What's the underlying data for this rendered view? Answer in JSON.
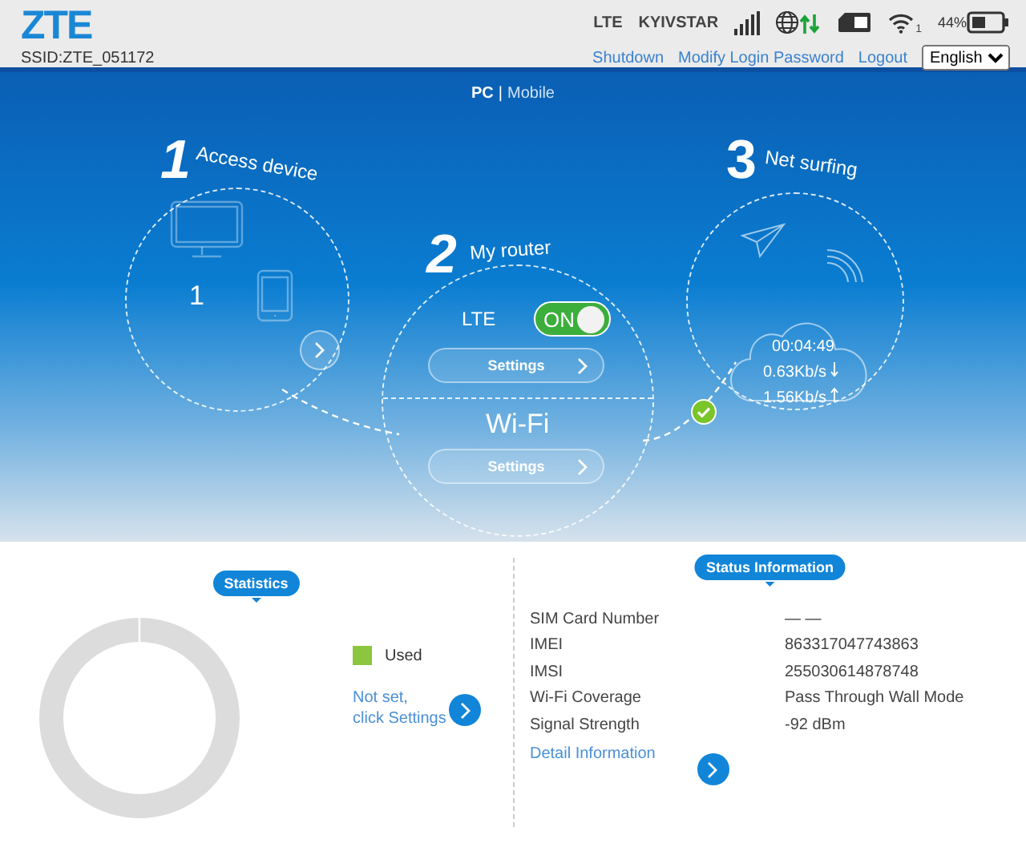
{
  "header": {
    "logo": "ZTE",
    "ssid": "SSID:ZTE_051172",
    "network_type": "LTE",
    "operator": "KYIVSTAR",
    "wifi_clients": "1",
    "battery_percent": "44%",
    "links": [
      "Shutdown",
      "Modify Login Password",
      "Logout"
    ],
    "language": "English"
  },
  "view_switch": [
    {
      "label": "PC",
      "selected": true
    },
    {
      "label": "Mobile",
      "selected": false
    }
  ],
  "view_separator": "|",
  "access_device": {
    "number": "1",
    "title": "Access device",
    "count": "1"
  },
  "my_router": {
    "number": "2",
    "title": "My router",
    "lte_label": "LTE",
    "lte_switch": {
      "label": "ON",
      "on": true
    },
    "lte_settings": "Settings",
    "wifi_label": "Wi-Fi",
    "wifi_settings": "Settings",
    "connected": true
  },
  "net_surfing": {
    "number": "3",
    "title": "Net surfing",
    "duration": "00:04:49",
    "download": "0.63Kb/s",
    "upload": "1.56Kb/s"
  },
  "statistics": {
    "title": "Statistics",
    "legend": [
      {
        "label": "Used",
        "color": "#8cc63f"
      }
    ],
    "hint": "Not set,\nclick Settings"
  },
  "status": {
    "title": "Status Information",
    "rows": [
      {
        "label": "SIM Card Number",
        "value": "— —"
      },
      {
        "label": "IMEI",
        "value": "863317047743863"
      },
      {
        "label": "IMSI",
        "value": "255030614878748"
      },
      {
        "label": "Wi-Fi Coverage",
        "value": "Pass Through Wall Mode"
      },
      {
        "label": "Signal Strength",
        "value": "-92 dBm"
      }
    ],
    "detail_link": "Detail Information"
  }
}
